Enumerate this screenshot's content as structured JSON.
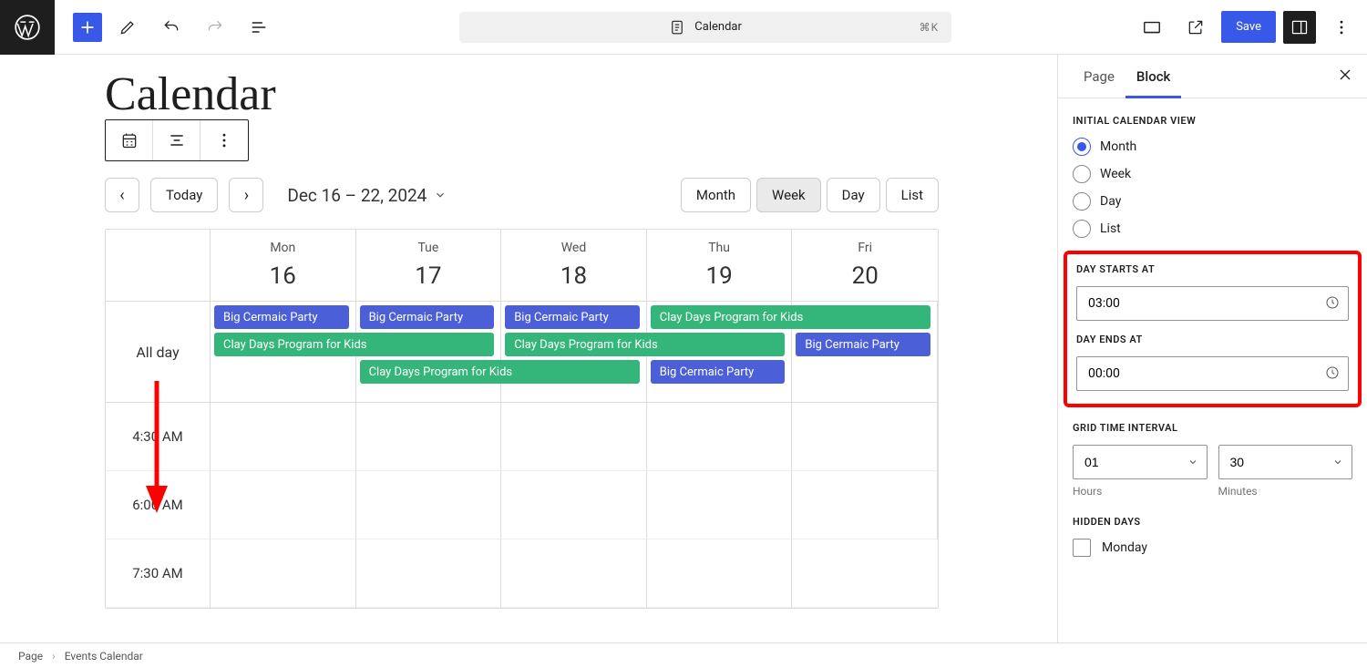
{
  "topbar": {
    "doc_title": "Calendar",
    "shortcut": "⌘K",
    "save_label": "Save"
  },
  "editor": {
    "page_title": "Calendar",
    "today_label": "Today",
    "date_range": "Dec 16 – 22, 2024",
    "views": {
      "month": "Month",
      "week": "Week",
      "day": "Day",
      "list": "List"
    },
    "days": [
      {
        "dow": "Mon",
        "num": "16"
      },
      {
        "dow": "Tue",
        "num": "17"
      },
      {
        "dow": "Wed",
        "num": "18"
      },
      {
        "dow": "Thu",
        "num": "19"
      },
      {
        "dow": "Fri",
        "num": "20"
      }
    ],
    "allday_label": "All day",
    "events": {
      "ceramic": "Big Cermaic Party",
      "clay": "Clay Days Program for Kids"
    },
    "time_slots": [
      "4:30 AM",
      "6:00 AM",
      "7:30 AM"
    ]
  },
  "sidebar": {
    "tabs": {
      "page": "Page",
      "block": "Block"
    },
    "initial_view": {
      "title": "Initial Calendar View",
      "options": {
        "month": "Month",
        "week": "Week",
        "day": "Day",
        "list": "List"
      }
    },
    "day_starts": {
      "title": "Day Starts At",
      "value": "03:00"
    },
    "day_ends": {
      "title": "Day Ends At",
      "value": "00:00"
    },
    "grid_interval": {
      "title": "Grid Time Interval",
      "hours_value": "01",
      "hours_label": "Hours",
      "minutes_value": "30",
      "minutes_label": "Minutes"
    },
    "hidden_days": {
      "title": "Hidden Days",
      "monday": "Monday"
    }
  },
  "footer": {
    "crumb1": "Page",
    "crumb2": "Events Calendar"
  }
}
